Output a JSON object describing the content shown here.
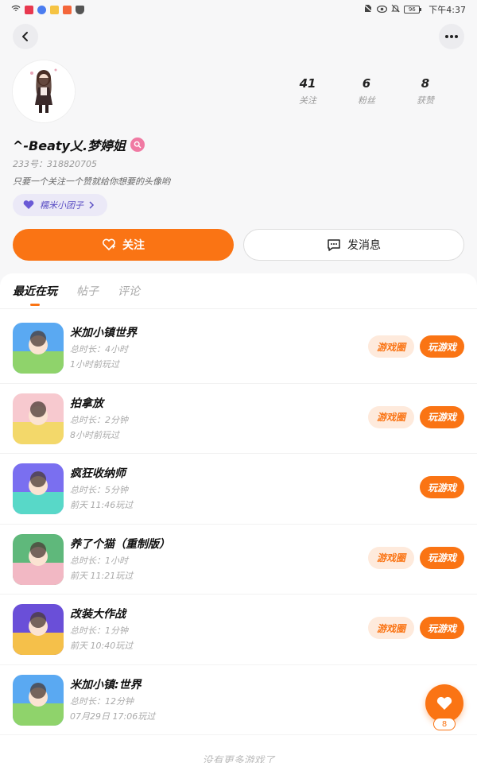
{
  "status_bar": {
    "time": "下午4:37",
    "battery": "96"
  },
  "profile": {
    "username": "^-Beaty乂.梦婷姐",
    "uid": "233号：318820705",
    "bio": "只要一个关注一个赞就给你想要的头像哟",
    "group_chip": "糯米小团子",
    "stats": [
      {
        "num": "41",
        "label": "关注"
      },
      {
        "num": "6",
        "label": "粉丝"
      },
      {
        "num": "8",
        "label": "获赞"
      }
    ]
  },
  "actions": {
    "follow_label": "关注",
    "message_label": "发消息"
  },
  "tabs": [
    "最近在玩",
    "帖子",
    "评论"
  ],
  "games": [
    {
      "name": "米加小镇世界",
      "duration": "总时长：4小时",
      "last_played": "1小时前玩过",
      "circle_btn": "游戏圈",
      "play_btn": "玩游戏",
      "colors": [
        "#5aa9f2",
        "#8fd36b"
      ]
    },
    {
      "name": "拍拿放",
      "duration": "总时长：2分钟",
      "last_played": "8小时前玩过",
      "circle_btn": "游戏圈",
      "play_btn": "玩游戏",
      "colors": [
        "#f7c9cf",
        "#f3d86a"
      ]
    },
    {
      "name": "疯狂收纳师",
      "duration": "总时长：5分钟",
      "last_played": "前天 11:46玩过",
      "circle_btn": "",
      "play_btn": "玩游戏",
      "colors": [
        "#7a6ff0",
        "#58d8c8"
      ]
    },
    {
      "name": "养了个猫（重制版）",
      "duration": "总时长：1小时",
      "last_played": "前天 11:21玩过",
      "circle_btn": "游戏圈",
      "play_btn": "玩游戏",
      "colors": [
        "#5fb87b",
        "#f2b8c4"
      ]
    },
    {
      "name": "改装大作战",
      "duration": "总时长：1分钟",
      "last_played": "前天 10:40玩过",
      "circle_btn": "游戏圈",
      "play_btn": "玩游戏",
      "colors": [
        "#6a4fd8",
        "#f5c04a"
      ]
    },
    {
      "name": "米加小镇:世界",
      "duration": "总时长：12分钟",
      "last_played": "07月29日 17:06玩过",
      "circle_btn": "",
      "play_btn": "",
      "colors": [
        "#5aa9f2",
        "#8fd36b"
      ]
    }
  ],
  "end_text": "没有更多游戏了",
  "fab": {
    "count": "8"
  },
  "accent_color": "#fa7414"
}
